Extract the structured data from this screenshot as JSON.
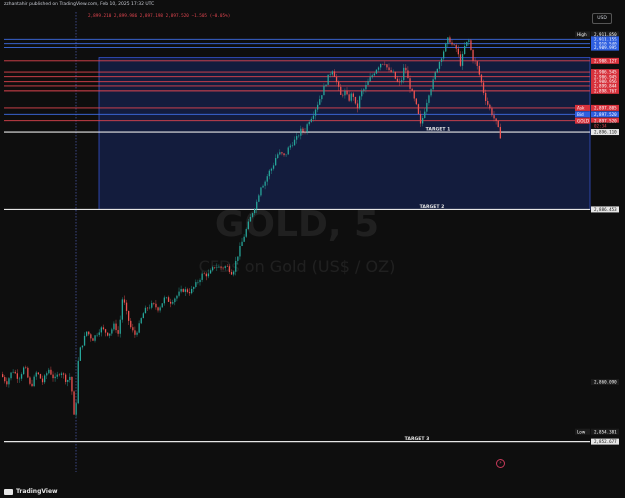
{
  "header": {
    "published": "zzhantahir published on TradingView.com, Feb 10, 2025 17:32 UTC",
    "ohlc": "2,899.210  2,899.986  2,897.198  2,897.520  −1.505 (−0.05%)",
    "currency": "USD"
  },
  "watermark": {
    "symbol": "GOLD, 5",
    "description": "CFDs on Gold (US$ / OZ)"
  },
  "branding": {
    "logo": "TradingView"
  },
  "icons": {
    "bolt": "lightning-icon"
  },
  "chart_data": {
    "type": "candlestick",
    "ylim": [
      2850.5,
      2913.6
    ],
    "colors": {
      "up": "#26a69a",
      "down": "#ef5350",
      "background": "#0e0e0e"
    },
    "price_path": [
      [
        0,
        2864.0
      ],
      [
        6,
        2862.8
      ],
      [
        12,
        2864.6
      ],
      [
        18,
        2863.4
      ],
      [
        24,
        2865.1
      ],
      [
        30,
        2862.1
      ],
      [
        36,
        2864.3
      ],
      [
        42,
        2862.9
      ],
      [
        48,
        2864.7
      ],
      [
        54,
        2863.2
      ],
      [
        60,
        2864.5
      ],
      [
        66,
        2863.0
      ],
      [
        70,
        2863.8
      ],
      [
        74,
        2857.0
      ],
      [
        76,
        2861.2
      ],
      [
        78,
        2866.9
      ],
      [
        82,
        2868.4
      ],
      [
        86,
        2870.0
      ],
      [
        92,
        2868.9
      ],
      [
        100,
        2870.5
      ],
      [
        108,
        2869.6
      ],
      [
        114,
        2871.0
      ],
      [
        118,
        2869.5
      ],
      [
        122,
        2875.0
      ],
      [
        126,
        2872.5
      ],
      [
        130,
        2870.6
      ],
      [
        134,
        2869.5
      ],
      [
        138,
        2870.6
      ],
      [
        142,
        2872.4
      ],
      [
        146,
        2873.3
      ],
      [
        152,
        2873.8
      ],
      [
        158,
        2873.2
      ],
      [
        164,
        2874.7
      ],
      [
        170,
        2874.2
      ],
      [
        176,
        2875.0
      ],
      [
        182,
        2875.9
      ],
      [
        190,
        2875.6
      ],
      [
        196,
        2876.8
      ],
      [
        202,
        2878.1
      ],
      [
        208,
        2878.0
      ],
      [
        214,
        2879.2
      ],
      [
        220,
        2879.0
      ],
      [
        226,
        2879.2
      ],
      [
        232,
        2878.2
      ],
      [
        236,
        2880.3
      ],
      [
        240,
        2882.0
      ],
      [
        244,
        2883.7
      ],
      [
        248,
        2885.3
      ],
      [
        252,
        2886.9
      ],
      [
        256,
        2888.2
      ],
      [
        260,
        2890.5
      ],
      [
        264,
        2891.0
      ],
      [
        268,
        2892.4
      ],
      [
        272,
        2893.2
      ],
      [
        276,
        2894.9
      ],
      [
        280,
        2895.1
      ],
      [
        284,
        2894.6
      ],
      [
        288,
        2895.9
      ],
      [
        292,
        2896.6
      ],
      [
        296,
        2897.2
      ],
      [
        300,
        2898.3
      ],
      [
        304,
        2898.2
      ],
      [
        308,
        2899.7
      ],
      [
        312,
        2900.5
      ],
      [
        316,
        2901.8
      ],
      [
        320,
        2903.1
      ],
      [
        324,
        2904.6
      ],
      [
        328,
        2906.0
      ],
      [
        332,
        2907.0
      ],
      [
        336,
        2905.1
      ],
      [
        340,
        2903.2
      ],
      [
        344,
        2903.8
      ],
      [
        348,
        2902.6
      ],
      [
        352,
        2903.7
      ],
      [
        356,
        2901.0
      ],
      [
        360,
        2903.6
      ],
      [
        364,
        2904.2
      ],
      [
        368,
        2905.3
      ],
      [
        372,
        2906.2
      ],
      [
        376,
        2907.1
      ],
      [
        380,
        2907.8
      ],
      [
        384,
        2908.0
      ],
      [
        388,
        2906.6
      ],
      [
        392,
        2906.5
      ],
      [
        396,
        2905.2
      ],
      [
        400,
        2904.8
      ],
      [
        404,
        2907.6
      ],
      [
        408,
        2905.1
      ],
      [
        412,
        2903.3
      ],
      [
        416,
        2901.6
      ],
      [
        420,
        2899.0
      ],
      [
        424,
        2901.2
      ],
      [
        428,
        2903.5
      ],
      [
        432,
        2905.0
      ],
      [
        436,
        2907.0
      ],
      [
        440,
        2908.5
      ],
      [
        444,
        2909.9
      ],
      [
        448,
        2911.4
      ],
      [
        452,
        2910.2
      ],
      [
        456,
        2909.8
      ],
      [
        460,
        2907.6
      ],
      [
        464,
        2910.1
      ],
      [
        468,
        2911.1
      ],
      [
        472,
        2908.5
      ],
      [
        476,
        2907.6
      ],
      [
        480,
        2905.5
      ],
      [
        484,
        2903.1
      ],
      [
        488,
        2901.7
      ],
      [
        492,
        2900.5
      ],
      [
        496,
        2899.2
      ],
      [
        500,
        2897.4
      ]
    ],
    "levels": [
      {
        "label": "2,911.850",
        "price": 2911.85,
        "kind": "axis",
        "tag": "High"
      },
      {
        "label": "2,911.155",
        "price": 2911.155,
        "kind": "blue"
      },
      {
        "label": "2,910.540",
        "price": 2910.54,
        "kind": "blue"
      },
      {
        "label": "2,909.995",
        "price": 2909.995,
        "kind": "blue"
      },
      {
        "label": "2,908.127",
        "price": 2908.127,
        "kind": "red"
      },
      {
        "label": "2,906.545",
        "price": 2906.545,
        "kind": "red"
      },
      {
        "label": "2,906.945",
        "price": 2905.9,
        "kind": "red"
      },
      {
        "label": "2,900.956",
        "price": 2905.2,
        "kind": "red"
      },
      {
        "label": "2,899.844",
        "price": 2904.6,
        "kind": "red"
      },
      {
        "label": "2,898.767",
        "price": 2903.9,
        "kind": "red"
      },
      {
        "label": "2,897.805",
        "price": 2901.5,
        "kind": "red",
        "tag": "Ask"
      },
      {
        "label": "2,897.520",
        "price": 2900.6,
        "kind": "blue",
        "tag": "Bid"
      },
      {
        "label": "2,897.520",
        "price": 2899.7,
        "kind": "red",
        "tag": "GOLD"
      },
      {
        "label": "02:34",
        "price": 2899.0,
        "kind": "timer"
      },
      {
        "label": "2,896.110",
        "price": 2898.1,
        "kind": "white",
        "name": "TARGET 1"
      },
      {
        "label": "2,886.453",
        "price": 2887.2,
        "kind": "white",
        "name": "TARGET 2"
      },
      {
        "label": "2,860.090",
        "price": 2862.9,
        "kind": "axis"
      },
      {
        "label": "2,854.381",
        "price": 2855.9,
        "kind": "axis",
        "tag": "Low"
      },
      {
        "label": "2,852.677",
        "price": 2854.5,
        "kind": "white",
        "name": "TARGET 3"
      }
    ],
    "zone": {
      "top": 2908.6,
      "bottom": 2887.2,
      "color": "#15224d"
    }
  }
}
